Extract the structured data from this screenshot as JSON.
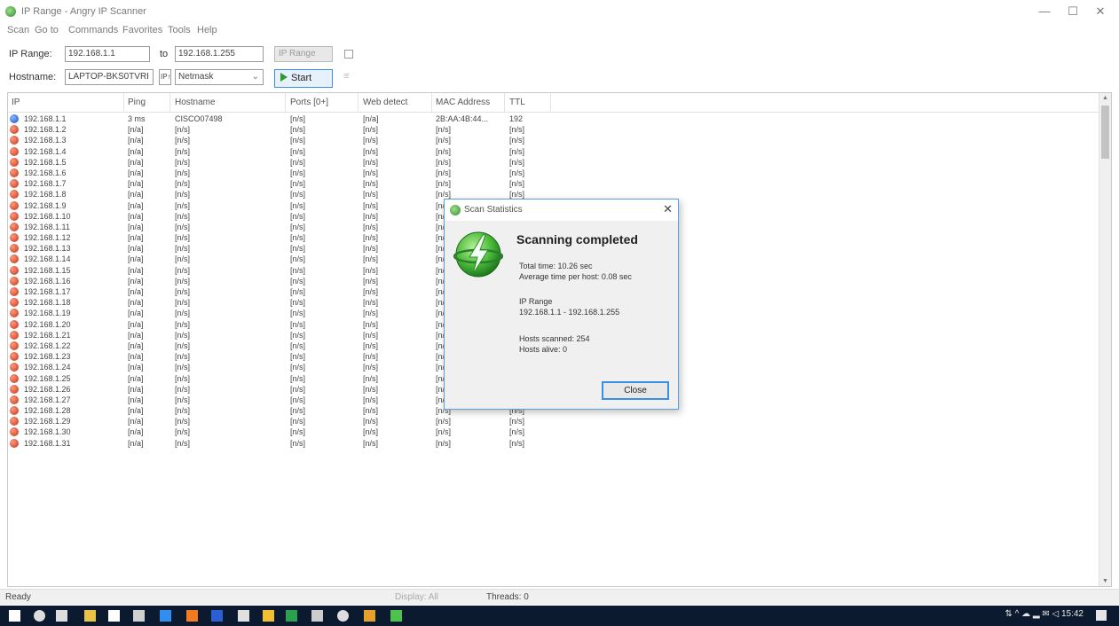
{
  "window": {
    "title": "IP Range - Angry IP Scanner",
    "controls": [
      "—",
      "☐",
      "✕"
    ]
  },
  "menu": [
    "Scan",
    "Go to",
    "Commands",
    "Favorites",
    "Tools",
    "Help"
  ],
  "toolbar": {
    "ip_range_label": "IP Range:",
    "ip_from": "192.168.1.1",
    "to_label": "to",
    "ip_to": "192.168.1.255",
    "range_type": "IP Range",
    "hostname_label": "Hostname:",
    "hostname": "LAPTOP-BKS0TVRI",
    "ip_button": "IP↑",
    "netmask": "Netmask",
    "start_label": "Start"
  },
  "columns": [
    "IP",
    "Ping",
    "Hostname",
    "Ports [0+]",
    "Web detect",
    "MAC Address",
    "TTL"
  ],
  "rows": [
    {
      "ip": "192.168.1.1",
      "ping": "3 ms",
      "hostname": "CISCO07498",
      "ports": "[n/s]",
      "web": "[n/a]",
      "mac": "2B:AA:4B:44...",
      "ttl": "192",
      "alive": true
    },
    {
      "ip": "192.168.1.2",
      "ping": "[n/a]",
      "hostname": "[n/s]",
      "ports": "[n/s]",
      "web": "[n/s]",
      "mac": "[n/s]",
      "ttl": "[n/s]",
      "alive": false
    },
    {
      "ip": "192.168.1.3",
      "ping": "[n/a]",
      "hostname": "[n/s]",
      "ports": "[n/s]",
      "web": "[n/s]",
      "mac": "[n/s]",
      "ttl": "[n/s]",
      "alive": false
    },
    {
      "ip": "192.168.1.4",
      "ping": "[n/a]",
      "hostname": "[n/s]",
      "ports": "[n/s]",
      "web": "[n/s]",
      "mac": "[n/s]",
      "ttl": "[n/s]",
      "alive": false
    },
    {
      "ip": "192.168.1.5",
      "ping": "[n/a]",
      "hostname": "[n/s]",
      "ports": "[n/s]",
      "web": "[n/s]",
      "mac": "[n/s]",
      "ttl": "[n/s]",
      "alive": false
    },
    {
      "ip": "192.168.1.6",
      "ping": "[n/a]",
      "hostname": "[n/s]",
      "ports": "[n/s]",
      "web": "[n/s]",
      "mac": "[n/s]",
      "ttl": "[n/s]",
      "alive": false
    },
    {
      "ip": "192.168.1.7",
      "ping": "[n/a]",
      "hostname": "[n/s]",
      "ports": "[n/s]",
      "web": "[n/s]",
      "mac": "[n/s]",
      "ttl": "[n/s]",
      "alive": false
    },
    {
      "ip": "192.168.1.8",
      "ping": "[n/a]",
      "hostname": "[n/s]",
      "ports": "[n/s]",
      "web": "[n/s]",
      "mac": "[n/s]",
      "ttl": "[n/s]",
      "alive": false
    },
    {
      "ip": "192.168.1.9",
      "ping": "[n/a]",
      "hostname": "[n/s]",
      "ports": "[n/s]",
      "web": "[n/s]",
      "mac": "[n/s]",
      "ttl": "[n/s]",
      "alive": false
    },
    {
      "ip": "192.168.1.10",
      "ping": "[n/a]",
      "hostname": "[n/s]",
      "ports": "[n/s]",
      "web": "[n/s]",
      "mac": "[n/s]",
      "ttl": "[n/s]",
      "alive": false
    },
    {
      "ip": "192.168.1.11",
      "ping": "[n/a]",
      "hostname": "[n/s]",
      "ports": "[n/s]",
      "web": "[n/s]",
      "mac": "[n/s]",
      "ttl": "[n/s]",
      "alive": false
    },
    {
      "ip": "192.168.1.12",
      "ping": "[n/a]",
      "hostname": "[n/s]",
      "ports": "[n/s]",
      "web": "[n/s]",
      "mac": "[n/s]",
      "ttl": "[n/s]",
      "alive": false
    },
    {
      "ip": "192.168.1.13",
      "ping": "[n/a]",
      "hostname": "[n/s]",
      "ports": "[n/s]",
      "web": "[n/s]",
      "mac": "[n/s]",
      "ttl": "[n/s]",
      "alive": false
    },
    {
      "ip": "192.168.1.14",
      "ping": "[n/a]",
      "hostname": "[n/s]",
      "ports": "[n/s]",
      "web": "[n/s]",
      "mac": "[n/s]",
      "ttl": "[n/s]",
      "alive": false
    },
    {
      "ip": "192.168.1.15",
      "ping": "[n/a]",
      "hostname": "[n/s]",
      "ports": "[n/s]",
      "web": "[n/s]",
      "mac": "[n/s]",
      "ttl": "[n/s]",
      "alive": false
    },
    {
      "ip": "192.168.1.16",
      "ping": "[n/a]",
      "hostname": "[n/s]",
      "ports": "[n/s]",
      "web": "[n/s]",
      "mac": "[n/s]",
      "ttl": "[n/s]",
      "alive": false
    },
    {
      "ip": "192.168.1.17",
      "ping": "[n/a]",
      "hostname": "[n/s]",
      "ports": "[n/s]",
      "web": "[n/s]",
      "mac": "[n/s]",
      "ttl": "[n/s]",
      "alive": false
    },
    {
      "ip": "192.168.1.18",
      "ping": "[n/a]",
      "hostname": "[n/s]",
      "ports": "[n/s]",
      "web": "[n/s]",
      "mac": "[n/s]",
      "ttl": "[n/s]",
      "alive": false
    },
    {
      "ip": "192.168.1.19",
      "ping": "[n/a]",
      "hostname": "[n/s]",
      "ports": "[n/s]",
      "web": "[n/s]",
      "mac": "[n/s]",
      "ttl": "[n/s]",
      "alive": false
    },
    {
      "ip": "192.168.1.20",
      "ping": "[n/a]",
      "hostname": "[n/s]",
      "ports": "[n/s]",
      "web": "[n/s]",
      "mac": "[n/s]",
      "ttl": "[n/s]",
      "alive": false
    },
    {
      "ip": "192.168.1.21",
      "ping": "[n/a]",
      "hostname": "[n/s]",
      "ports": "[n/s]",
      "web": "[n/s]",
      "mac": "[n/s]",
      "ttl": "[n/s]",
      "alive": false
    },
    {
      "ip": "192.168.1.22",
      "ping": "[n/a]",
      "hostname": "[n/s]",
      "ports": "[n/s]",
      "web": "[n/s]",
      "mac": "[n/s]",
      "ttl": "[n/s]",
      "alive": false
    },
    {
      "ip": "192.168.1.23",
      "ping": "[n/a]",
      "hostname": "[n/s]",
      "ports": "[n/s]",
      "web": "[n/s]",
      "mac": "[n/s]",
      "ttl": "[n/s]",
      "alive": false
    },
    {
      "ip": "192.168.1.24",
      "ping": "[n/a]",
      "hostname": "[n/s]",
      "ports": "[n/s]",
      "web": "[n/s]",
      "mac": "[n/s]",
      "ttl": "[n/s]",
      "alive": false
    },
    {
      "ip": "192.168.1.25",
      "ping": "[n/a]",
      "hostname": "[n/s]",
      "ports": "[n/s]",
      "web": "[n/s]",
      "mac": "[n/s]",
      "ttl": "[n/s]",
      "alive": false
    },
    {
      "ip": "192.168.1.26",
      "ping": "[n/a]",
      "hostname": "[n/s]",
      "ports": "[n/s]",
      "web": "[n/s]",
      "mac": "[n/s]",
      "ttl": "[n/s]",
      "alive": false
    },
    {
      "ip": "192.168.1.27",
      "ping": "[n/a]",
      "hostname": "[n/s]",
      "ports": "[n/s]",
      "web": "[n/s]",
      "mac": "[n/s]",
      "ttl": "[n/s]",
      "alive": false
    },
    {
      "ip": "192.168.1.28",
      "ping": "[n/a]",
      "hostname": "[n/s]",
      "ports": "[n/s]",
      "web": "[n/s]",
      "mac": "[n/s]",
      "ttl": "[n/s]",
      "alive": false
    },
    {
      "ip": "192.168.1.29",
      "ping": "[n/a]",
      "hostname": "[n/s]",
      "ports": "[n/s]",
      "web": "[n/s]",
      "mac": "[n/s]",
      "ttl": "[n/s]",
      "alive": false
    },
    {
      "ip": "192.168.1.30",
      "ping": "[n/a]",
      "hostname": "[n/s]",
      "ports": "[n/s]",
      "web": "[n/s]",
      "mac": "[n/s]",
      "ttl": "[n/s]",
      "alive": false
    },
    {
      "ip": "192.168.1.31",
      "ping": "[n/a]",
      "hostname": "[n/s]",
      "ports": "[n/s]",
      "web": "[n/s]",
      "mac": "[n/s]",
      "ttl": "[n/s]",
      "alive": false
    }
  ],
  "statusbar": {
    "status": "Ready",
    "display": "Display: All",
    "threads": "Threads: 0"
  },
  "dialog": {
    "title": "Scan Statistics",
    "heading": "Scanning completed",
    "total_time": "Total time: 10.26 sec",
    "avg_time": "Average time per host: 0.08 sec",
    "range_label": "IP Range",
    "range_value": "192.168.1.1 - 192.168.1.255",
    "hosts_scanned": "Hosts scanned: 254",
    "hosts_alive": "Hosts alive: 0",
    "close_label": "Close"
  },
  "taskbar": {
    "tray": "⇅ ^ ☁ ▂ ✉ ◁ 15:42",
    "icons": [
      "windows-start-icon",
      "search-icon",
      "task-view-icon",
      "file-explorer-icon",
      "store-icon",
      "mail-icon",
      "edge-icon",
      "firefox-icon",
      "word-icon",
      "app-icon",
      "chrome-icon",
      "excel-icon",
      "media-icon",
      "settings-icon",
      "photos-icon",
      "ipscan-icon"
    ],
    "colors": {
      "background": "#0b1a2e",
      "dead_host": "#c0301c",
      "alive_host": "#1d4fc0",
      "accent": "#3a8ee6"
    }
  }
}
